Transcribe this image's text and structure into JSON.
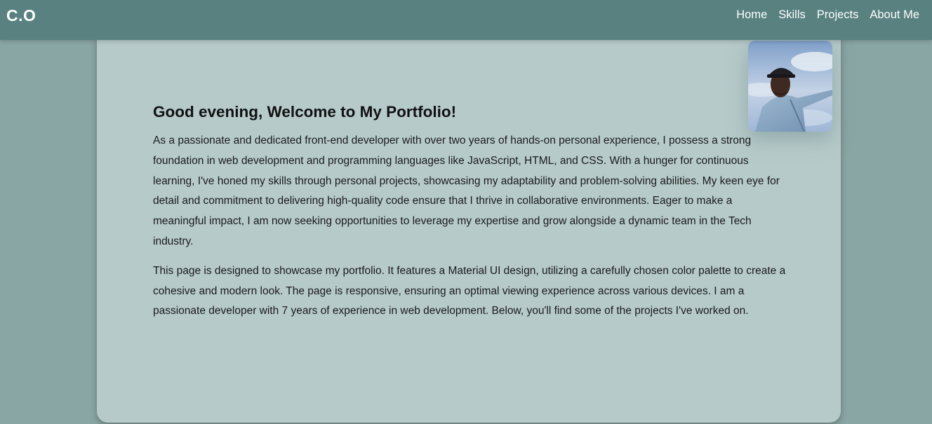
{
  "navbar": {
    "brand": "C.O",
    "links": [
      "Home",
      "Skills",
      "Projects",
      "About Me"
    ],
    "background_color": "#588180"
  },
  "hero": {
    "greeting": "Good evening, Welcome to My Portfolio!",
    "paragraphs": [
      "As a passionate and dedicated front-end developer with over two years of hands-on personal experience, I possess a strong foundation in web development and programming languages like JavaScript, HTML, and CSS. With a hunger for continuous learning, I've honed my skills through personal projects, showcasing my adaptability and problem-solving abilities. My keen eye for detail and commitment to delivering high-quality code ensure that I thrive in collaborative environments. Eager to make a meaningful impact, I am now seeking opportunities to leverage my expertise and grow alongside a dynamic team in the Tech industry.",
      "This page is designed to showcase my portfolio. It features a Material UI design, utilizing a carefully chosen color palette to create a cohesive and modern look. The page is responsive, ensuring an optimal viewing experience across various devices. I am a passionate developer with 7 years of experience in web development. Below, you'll find some of the projects I've worked on."
    ],
    "avatar_icon": "profile-photo",
    "card_color": "#b7caca",
    "page_background": "#8aa6a4"
  }
}
